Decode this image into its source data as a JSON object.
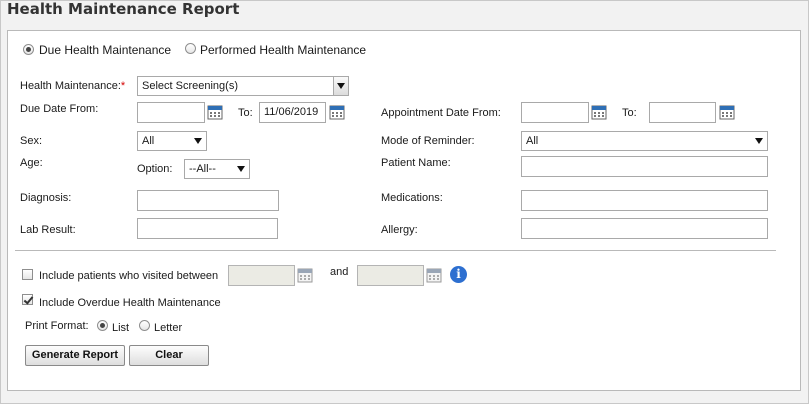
{
  "title": "Health Maintenance Report",
  "report_type": {
    "due_label": "Due Health Maintenance",
    "performed_label": "Performed Health Maintenance",
    "selected": "due"
  },
  "fields": {
    "health_maintenance": {
      "label": "Health Maintenance:",
      "required_mark": "*",
      "value": "Select Screening(s)"
    },
    "due_date_from": {
      "label": "Due Date From:",
      "value": ""
    },
    "due_date_to": {
      "label": "To:",
      "value": "11/06/2019"
    },
    "appointment_date_from": {
      "label": "Appointment Date From:",
      "value": ""
    },
    "appointment_date_to": {
      "label": "To:",
      "value": ""
    },
    "sex": {
      "label": "Sex:",
      "value": "All"
    },
    "mode_of_reminder": {
      "label": "Mode of Reminder:",
      "value": "All"
    },
    "age": {
      "label": "Age:",
      "option_label": "Option:",
      "option_value": "--All--"
    },
    "patient_name": {
      "label": "Patient Name:",
      "value": ""
    },
    "diagnosis": {
      "label": "Diagnosis:",
      "value": ""
    },
    "medications": {
      "label": "Medications:",
      "value": ""
    },
    "lab_result": {
      "label": "Lab Result:",
      "value": ""
    },
    "allergy": {
      "label": "Allergy:",
      "value": ""
    }
  },
  "visited_between": {
    "label": "Include patients who visited between",
    "checked": false,
    "and_label": "and",
    "start_value": "",
    "end_value": ""
  },
  "overdue": {
    "label": "Include Overdue Health Maintenance",
    "checked": true
  },
  "print_format": {
    "label": "Print Format:",
    "list_label": "List",
    "letter_label": "Letter",
    "selected": "list"
  },
  "buttons": {
    "generate": "Generate Report",
    "clear": "Clear"
  },
  "icons": {
    "calendar": "calendar-icon",
    "info": "info-icon"
  },
  "colors": {
    "required": "#d40000",
    "info": "#2d6fd0"
  }
}
